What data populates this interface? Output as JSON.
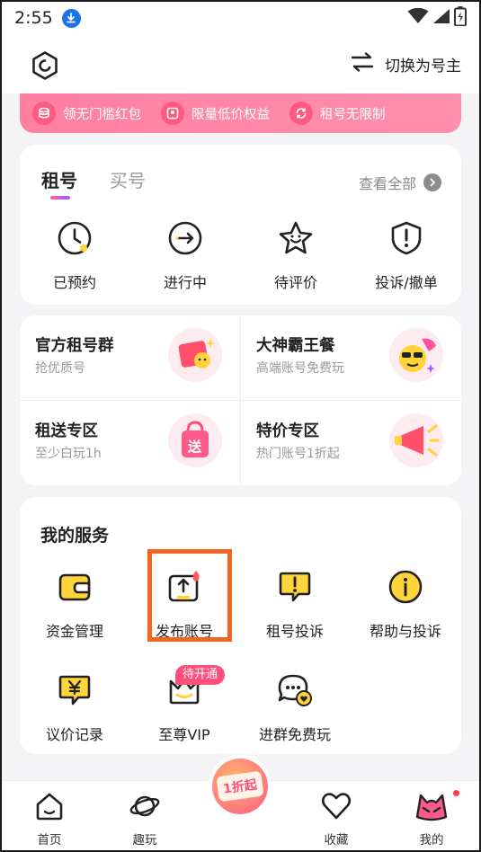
{
  "status_bar": {
    "time": "2:55"
  },
  "header": {
    "switch_label": "切换为号主"
  },
  "promo": {
    "items": [
      {
        "label": "领无门槛红包",
        "icon": "coin-stack-icon"
      },
      {
        "label": "限量低价权益",
        "icon": "voucher-icon"
      },
      {
        "label": "租号无限制",
        "icon": "refresh-icon"
      }
    ]
  },
  "rent_card": {
    "tabs": [
      "租号",
      "买号"
    ],
    "view_all": "查看全部",
    "orders": [
      "已预约",
      "进行中",
      "待评价",
      "投诉/撤单"
    ]
  },
  "zones": [
    {
      "title": "官方租号群",
      "subtitle": "抢优质号"
    },
    {
      "title": "大神霸王餐",
      "subtitle": "高端账号免费玩"
    },
    {
      "title": "租送专区",
      "subtitle": "至少白玩1h",
      "badge": "送"
    },
    {
      "title": "特价专区",
      "subtitle": "热门账号1折起"
    }
  ],
  "services": {
    "title": "我的服务",
    "items": [
      "资金管理",
      "发布账号",
      "租号投诉",
      "帮助与投诉",
      "议价记录",
      "至尊VIP",
      "进群免费玩"
    ],
    "vip_badge": "待开通"
  },
  "bottom_nav": {
    "items": [
      "首页",
      "趣玩",
      "收藏",
      "我的"
    ],
    "center_label": "1折起"
  },
  "colors": {
    "accent_pink": "#ff4f7b",
    "highlight_orange": "#f26522",
    "icon_yellow": "#ffd43b"
  }
}
